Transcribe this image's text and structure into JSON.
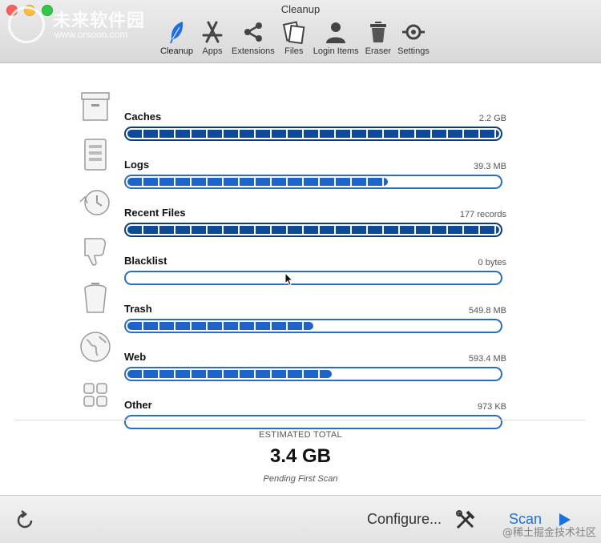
{
  "window": {
    "title": "Cleanup"
  },
  "watermark": {
    "title": "未来软件园",
    "url": "www.orsoon.com"
  },
  "tabs": [
    {
      "label": "Cleanup",
      "icon": "feather-icon",
      "active": true
    },
    {
      "label": "Apps",
      "icon": "app-store-icon",
      "active": false
    },
    {
      "label": "Extensions",
      "icon": "share-icon",
      "active": false
    },
    {
      "label": "Files",
      "icon": "files-icon",
      "active": false
    },
    {
      "label": "Login Items",
      "icon": "person-icon",
      "active": false
    },
    {
      "label": "Eraser",
      "icon": "trash-icon",
      "active": false
    },
    {
      "label": "Settings",
      "icon": "settings-icon",
      "active": false
    }
  ],
  "categories": [
    {
      "label": "Caches",
      "value": "2.2 GB",
      "fill": 1.0,
      "icon": "box-icon"
    },
    {
      "label": "Logs",
      "value": "39.3 MB",
      "fill": 0.7,
      "icon": "log-icon"
    },
    {
      "label": "Recent Files",
      "value": "177 records",
      "fill": 1.0,
      "icon": "history-icon"
    },
    {
      "label": "Blacklist",
      "value": "0 bytes",
      "fill": 0.0,
      "icon": "thumbs-down-icon"
    },
    {
      "label": "Trash",
      "value": "549.8 MB",
      "fill": 0.5,
      "icon": "trash-can-icon"
    },
    {
      "label": "Web",
      "value": "593.4 MB",
      "fill": 0.55,
      "icon": "globe-icon"
    },
    {
      "label": "Other",
      "value": "973 KB",
      "fill": 0.0,
      "icon": "grid-icon"
    }
  ],
  "summary": {
    "label": "ESTIMATED TOTAL",
    "value": "3.4 GB",
    "status": "Pending First Scan"
  },
  "bottom": {
    "configure_label": "Configure...",
    "scan_label": "Scan"
  },
  "footer_watermark": "@稀土掘金技术社区",
  "colors": {
    "accent": "#2a6cc6",
    "full_bar": "#0d4a97",
    "scan": "#1a73d9"
  }
}
